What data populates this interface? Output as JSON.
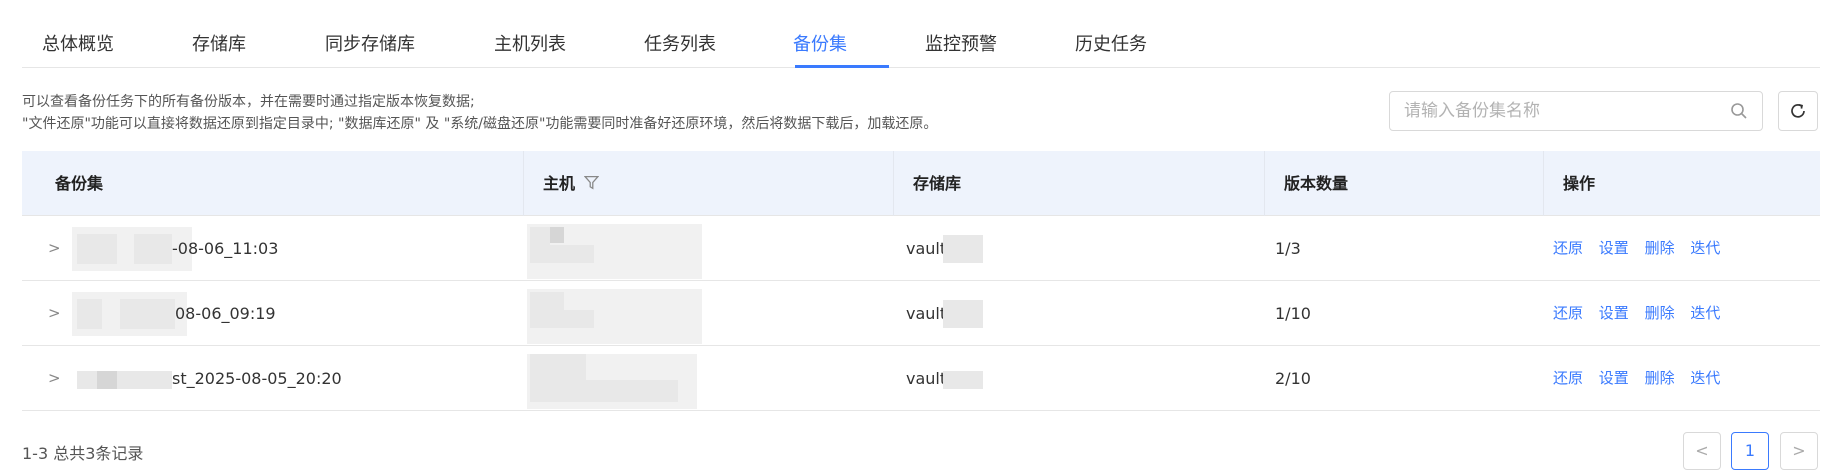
{
  "tabs": [
    {
      "label": "总体概览"
    },
    {
      "label": "存储库"
    },
    {
      "label": "同步存储库"
    },
    {
      "label": "主机列表"
    },
    {
      "label": "任务列表"
    },
    {
      "label": "备份集",
      "active": true
    },
    {
      "label": "监控预警"
    },
    {
      "label": "历史任务"
    }
  ],
  "info": {
    "line1": "可以查看备份任务下的所有备份版本，并在需要时通过指定版本恢复数据;",
    "line2": "\"文件还原\"功能可以直接将数据还原到指定目录中; \"数据库还原\" 及 \"系统/磁盘还原\"功能需要同时准备好还原环境，然后将数据下载后，加载还原。"
  },
  "search": {
    "placeholder": "请输入备份集名称",
    "value": ""
  },
  "icons": {
    "search": "search-icon",
    "refresh": "refresh-icon",
    "filter": "filter-icon",
    "expand": "chevron-right-icon"
  },
  "colors": {
    "accent": "#3a7afe",
    "header_bg": "#eef3fc"
  },
  "table": {
    "columns": {
      "backup_set": "备份集",
      "host": "主机",
      "vault": "存储库",
      "versions": "版本数量",
      "actions": "操作"
    },
    "rows": [
      {
        "backup_set": "-08-06_11:03",
        "vault": "vault-",
        "versions": "1/3"
      },
      {
        "backup_set": "08-06_09:19",
        "vault": "vault-",
        "versions": "1/10"
      },
      {
        "backup_set": "st_2025-08-05_20:20",
        "vault": "vault-",
        "versions": "2/10"
      }
    ],
    "actions": {
      "restore": "还原",
      "settings": "设置",
      "delete": "删除",
      "iterate": "迭代"
    }
  },
  "pagination": {
    "summary": "1-3 总共3条记录",
    "current_page": "1",
    "prev": "<",
    "next": ">"
  }
}
